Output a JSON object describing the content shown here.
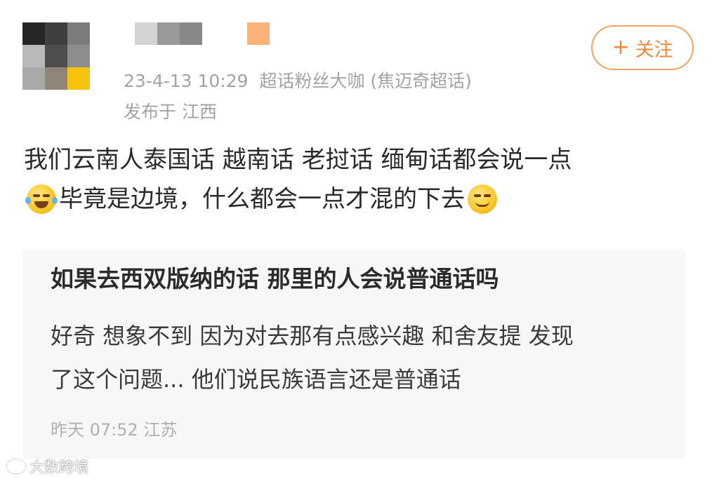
{
  "post": {
    "author": {
      "avatar_colors": [
        "#262626",
        "#3f3f3f",
        "#7c7c7c",
        "#b9b9b9",
        "#4e4e4e",
        "#8e8e8e",
        "#a9a9a9",
        "#8f8679",
        "#f5c20d"
      ],
      "name_colors": [
        "#d4d4d4",
        "#9a9a9a",
        "#888888"
      ],
      "badge_color": "#f8b27a",
      "timestamp": "23-4-13 10:29",
      "source": "超话粉丝大咖 (焦迈奇超话)",
      "location": "发布于 江西"
    },
    "follow_button": {
      "icon": "plus-icon",
      "label": "关注"
    },
    "text": {
      "line1": "我们云南人泰国话 越南话 老挝话 缅甸话都会说一点",
      "line2": "毕竟是边境，什么都会一点才混的下去"
    },
    "emojis": [
      "laugh-cry-emoji",
      "smirk-emoji"
    ]
  },
  "quoted": {
    "title": "如果去西双版纳的话 那里的人会说普通话吗",
    "body": {
      "line1": "好奇 想象不到 因为对去那有点感兴趣 和舍友提 发现",
      "line2": "了这个问题... 他们说民族语言还是普通话"
    },
    "meta": "昨天 07:52 江苏"
  },
  "watermark": {
    "icon": "weibo-logo-icon",
    "text": "大数跨境"
  },
  "colors": {
    "accent": "#f08a3c",
    "meta_text": "#a3a3a3",
    "card_bg": "#f7f7f7"
  }
}
